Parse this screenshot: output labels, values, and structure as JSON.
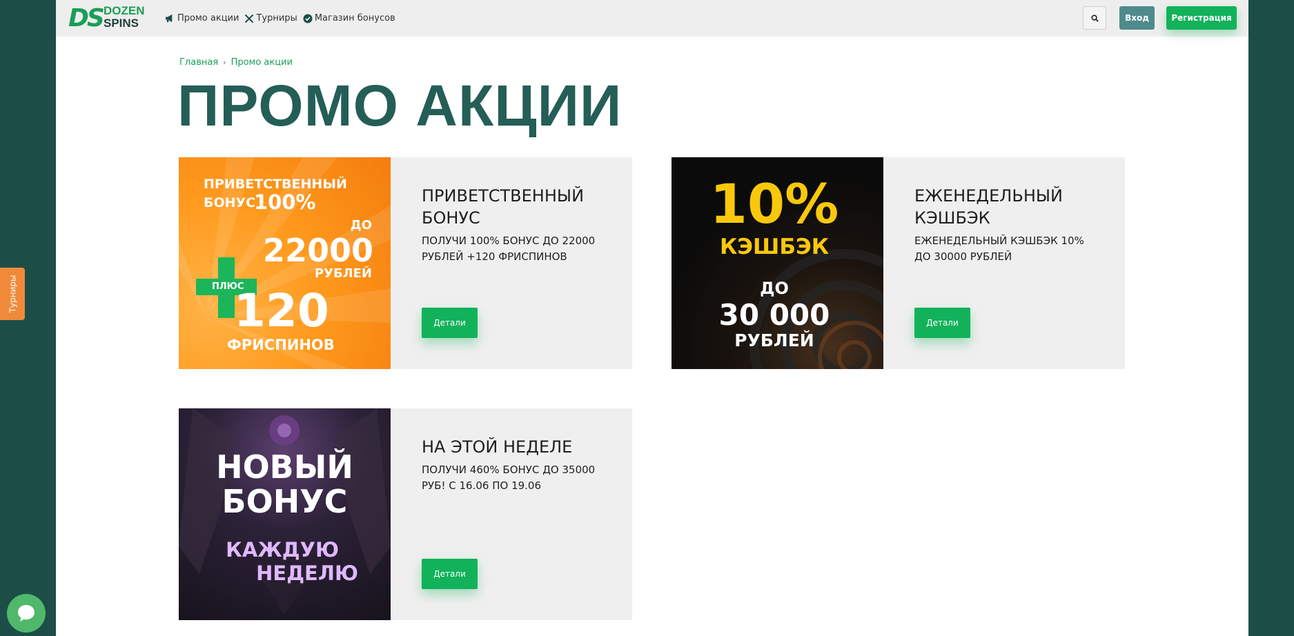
{
  "logo": {
    "mark": "DS",
    "line1": "DOZEN",
    "line2": "SPINS"
  },
  "nav": {
    "items": [
      {
        "label": "Промо акции",
        "icon": "megaphone-icon"
      },
      {
        "label": "Турниры",
        "icon": "crossed-swords-icon"
      },
      {
        "label": "Магазин бонусов",
        "icon": "check-badge-icon"
      }
    ]
  },
  "header": {
    "login_label": "Вход",
    "register_label": "Регистрация",
    "search_icon": "search-icon"
  },
  "breadcrumb": {
    "home": "Главная",
    "current": "Промо акции"
  },
  "page_title": "ПРОМО АКЦИИ",
  "colors": {
    "brand_green": "#12b25a",
    "title_teal": "#245e57",
    "sidebar_bg": "#1c4e47",
    "side_tab_orange": "#f08a3a"
  },
  "promos": [
    {
      "title": "ПРИВЕТСТВЕННЫЙ БОНУС",
      "description": "ПОЛУЧИ 100% БОНУС ДО 22000 РУБЛЕЙ +120 ФРИСПИНОВ",
      "button": "Детали",
      "banner": {
        "line1": "ПРИВЕТСТВЕННЫЙ",
        "line2a": "БОНУС",
        "line2b": "100%",
        "line3": "ДО",
        "line4": "22000",
        "line5": "РУБЛЕЙ",
        "plus_label": "ПЛЮС",
        "line6": "120",
        "line7": "ФРИСПИНОВ"
      }
    },
    {
      "title": "ЕЖЕНЕДЕЛЬНЫЙ КЭШБЭК",
      "description": "ЕЖЕНЕДЕЛЬНЫЙ КЭШБЭК 10% ДО 30000 РУБЛЕЙ",
      "button": "Детали",
      "banner": {
        "line1": "10%",
        "line2": "КЭШБЭК",
        "line3": "ДО",
        "line4": "30 000",
        "line5": "РУБЛЕЙ"
      }
    },
    {
      "title": "НА ЭТОЙ НЕДЕЛЕ",
      "description": "ПОЛУЧИ 460% БОНУС ДО 35000 РУБ! С 16.06 ПО 19.06",
      "button": "Детали",
      "banner": {
        "line1": "НОВЫЙ",
        "line2": "БОНУС",
        "line3": "КАЖДУЮ",
        "line4": "НЕДЕЛЮ"
      }
    }
  ],
  "side_tab": {
    "label": "Турниры"
  },
  "chat": {
    "icon": "chat-bubble-icon"
  }
}
